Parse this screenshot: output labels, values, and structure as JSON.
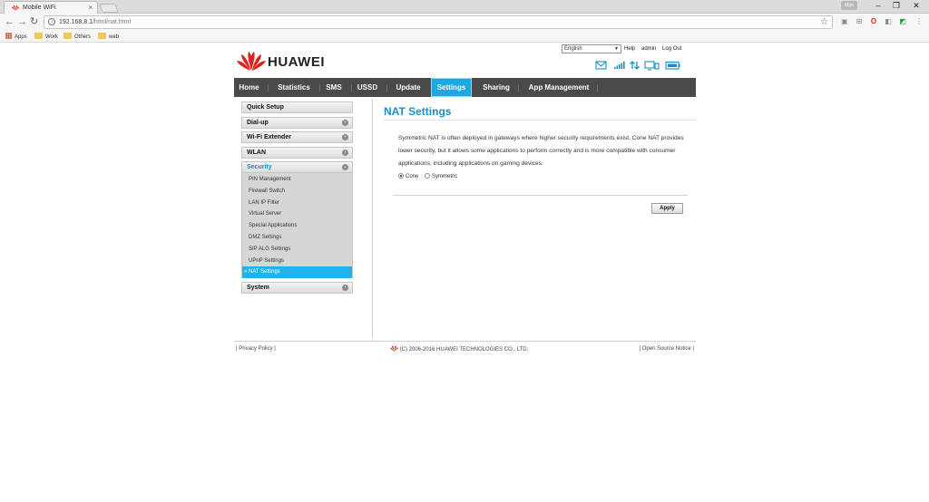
{
  "browser": {
    "tab_title": "Mobile WiFi",
    "user_badge": "Mgo",
    "url_host": "192.168.8.1",
    "url_path": "/html/nat.html",
    "bookmarks": [
      {
        "label": "Apps"
      },
      {
        "label": "Work"
      },
      {
        "label": "Others"
      },
      {
        "label": "web"
      }
    ]
  },
  "header": {
    "brand": "HUAWEI",
    "language": "English",
    "links": {
      "help": "Help",
      "user": "admin",
      "logout": "Log Out"
    }
  },
  "nav": {
    "items": [
      {
        "label": "Home"
      },
      {
        "label": "Statistics"
      },
      {
        "label": "SMS"
      },
      {
        "label": "USSD"
      },
      {
        "label": "Update"
      },
      {
        "label": "Settings"
      },
      {
        "label": "Sharing"
      },
      {
        "label": "App Management"
      }
    ],
    "active": "Settings"
  },
  "sidebar": {
    "quick_setup": "Quick Setup",
    "dialup": "Dial-up",
    "wifi_extender": "Wi-Fi Extender",
    "wlan": "WLAN",
    "security": "Security",
    "security_items": [
      {
        "label": "PIN Management"
      },
      {
        "label": "Firewall Switch"
      },
      {
        "label": "LAN IP Filter"
      },
      {
        "label": "Virtual Server"
      },
      {
        "label": "Special Applications"
      },
      {
        "label": "DMZ Settings"
      },
      {
        "label": "SIP ALG Settings"
      },
      {
        "label": "UPnP Settings"
      },
      {
        "label": "» NAT Settings"
      }
    ],
    "system": "System"
  },
  "content": {
    "title": "NAT Settings",
    "description": "Symmetric NAT is often deployed in gateways where higher security requirements exist. Cone NAT provides lower security, but it allows some applications to perform correctly and is more compatible with consumer applications, including applications on gaming devices.",
    "options": [
      {
        "label": "Cone",
        "checked": true
      },
      {
        "label": "Symmetric",
        "checked": false
      }
    ],
    "apply_label": "Apply"
  },
  "footer": {
    "privacy": "Privacy Policy",
    "copyright": "(C) 2006-2016 HUAWEI TECHNOLOGIES CO., LTD.",
    "open_source": "Open Source Notice"
  },
  "colors": {
    "accent": "#1aa9e0",
    "nav_bg": "#4a4a4a",
    "title": "#1a8fc4",
    "brand_red": "#e0231a"
  }
}
